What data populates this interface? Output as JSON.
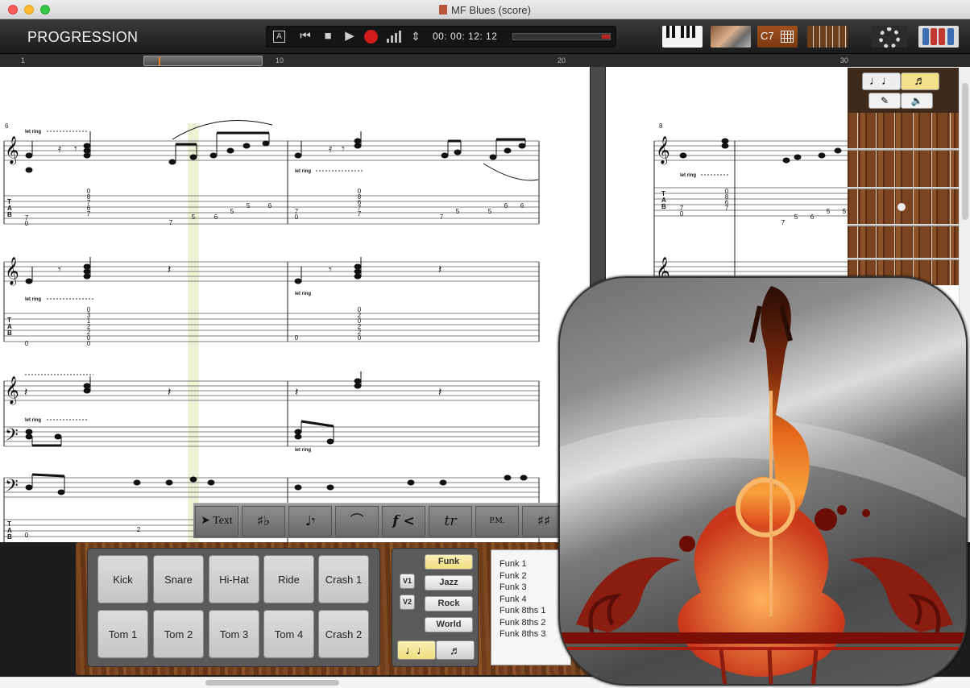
{
  "window": {
    "title": "MF Blues (score)"
  },
  "toolbar": {
    "section_label": "PROGRESSION",
    "timecode": "00: 00: 12: 12",
    "chord_button": "C7",
    "transport": {
      "text_mode": "A",
      "rewind": "⏮",
      "stop": "■",
      "play": "▶",
      "updown": "⇕"
    }
  },
  "ruler": {
    "ticks": [
      "1",
      "10",
      "20",
      "30"
    ]
  },
  "score": {
    "measure_numbers": [
      "6",
      "8"
    ],
    "let_ring": "let ring",
    "pm": "P.M."
  },
  "fretboard": {
    "note_modes": [
      "♩♩",
      "♬"
    ],
    "tools": [
      "✎",
      "🔈"
    ]
  },
  "palette": {
    "tools": [
      {
        "name": "text",
        "label": "Text"
      },
      {
        "name": "accidentals",
        "label": "♯♭"
      },
      {
        "name": "notes-rests",
        "label": "♩𝄾"
      },
      {
        "name": "articulation",
        "label": "⌒"
      },
      {
        "name": "dynamics",
        "label": "f <"
      },
      {
        "name": "ornaments",
        "label": "tr"
      },
      {
        "name": "palm-mute",
        "label": "P.M."
      },
      {
        "name": "key-signature",
        "label": "♯♯"
      }
    ]
  },
  "drum_pads": [
    "Kick",
    "Snare",
    "Hi-Hat",
    "Ride",
    "Crash 1",
    "Tom 1",
    "Tom 2",
    "Tom 3",
    "Tom 4",
    "Crash 2"
  ],
  "styles": {
    "categories": [
      "Funk",
      "Jazz",
      "Rock",
      "World"
    ],
    "selected": "Funk",
    "voices": [
      "V1",
      "V2"
    ]
  },
  "pattern_list": [
    "Funk 1",
    "Funk 2",
    "Funk 3",
    "Funk 4",
    "Funk 8ths 1",
    "Funk 8ths 2",
    "Funk 8ths 3"
  ],
  "colors": {
    "accent_selected": "#f3e08a",
    "record": "#d21c1c",
    "wood": "#7e4820",
    "toolbar": "#1b1b1b"
  }
}
